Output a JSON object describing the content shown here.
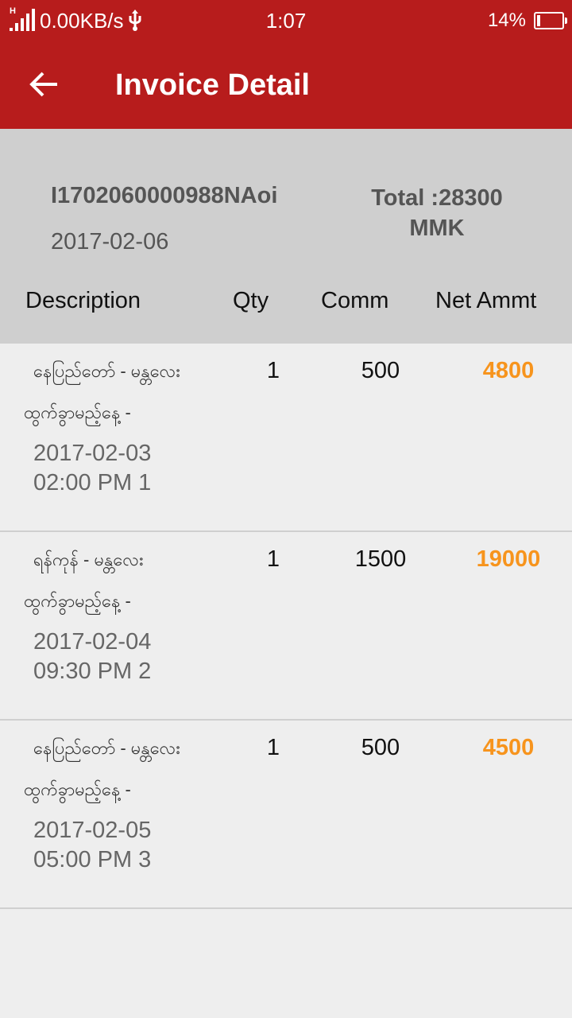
{
  "status_bar": {
    "network_type": "H",
    "speed": "0.00KB/s",
    "time": "1:07",
    "battery": "14%",
    "battery_level": 0.14,
    "icons": [
      "signal-icon",
      "usb-icon",
      "battery-icon"
    ]
  },
  "toolbar": {
    "title": "Invoice Detail",
    "back_icon": "arrow-left-icon",
    "color": "#b71c1c"
  },
  "summary": {
    "invoice_no": "I1702060000988NAoi",
    "date": "2017-02-06",
    "total": "Total :28300 MMK"
  },
  "columns": {
    "description": "Description",
    "qty": "Qty",
    "comm": "Comm",
    "net": "Net Ammt"
  },
  "rows": [
    {
      "route": "နေပြည်တော် - မန္တလေး",
      "departure_label": "ထွက်ခွာမည့်နေ့ -",
      "datetime": "2017-02-03\n02:00 PM 1",
      "qty": "1",
      "comm": "500",
      "net": "4800"
    },
    {
      "route": "ရန်ကုန် - မန္တလေး",
      "departure_label": "ထွက်ခွာမည့်နေ့ -",
      "datetime": "2017-02-04\n09:30 PM 2",
      "qty": "1",
      "comm": "1500",
      "net": "19000"
    },
    {
      "route": "နေပြည်တော် - မန္တလေး",
      "departure_label": "ထွက်ခွာမည့်နေ့ -",
      "datetime": "2017-02-05\n05:00 PM 3",
      "qty": "1",
      "comm": "500",
      "net": "4500"
    }
  ],
  "colors": {
    "primary": "#b71c1c",
    "net_amount": "#f7941d",
    "header_bg": "#cfcfcf",
    "row_bg": "#eeeeee"
  }
}
